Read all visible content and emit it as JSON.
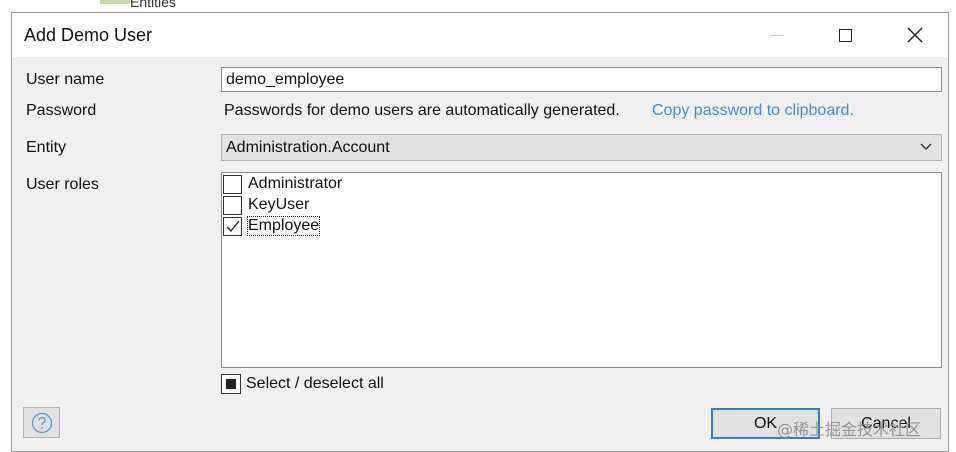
{
  "background": {
    "partial_text": "Entities"
  },
  "dialog": {
    "title": "Add Demo User",
    "window_buttons": {
      "minimize_icon": "minimize-icon",
      "maximize_icon": "maximize-icon",
      "close_icon": "close-icon"
    }
  },
  "form": {
    "username": {
      "label": "User name",
      "value": "demo_employee"
    },
    "password": {
      "label": "Password",
      "info": "Passwords for demo users are automatically generated.",
      "link": "Copy password to clipboard."
    },
    "entity": {
      "label": "Entity",
      "selected": "Administration.Account"
    },
    "user_roles": {
      "label": "User roles",
      "items": [
        {
          "label": "Administrator",
          "checked": false
        },
        {
          "label": "KeyUser",
          "checked": false
        },
        {
          "label": "Employee",
          "checked": true
        }
      ]
    },
    "select_all_label": "Select / deselect all"
  },
  "footer": {
    "ok_label": "OK",
    "cancel_label": "Cancel",
    "help_icon": "help-icon"
  },
  "watermark": "@稀土掘金技术社区",
  "colors": {
    "link": "#3e8fd9",
    "dialog_bg": "#f0f0f0",
    "ok_border": "#2f7fcf"
  }
}
